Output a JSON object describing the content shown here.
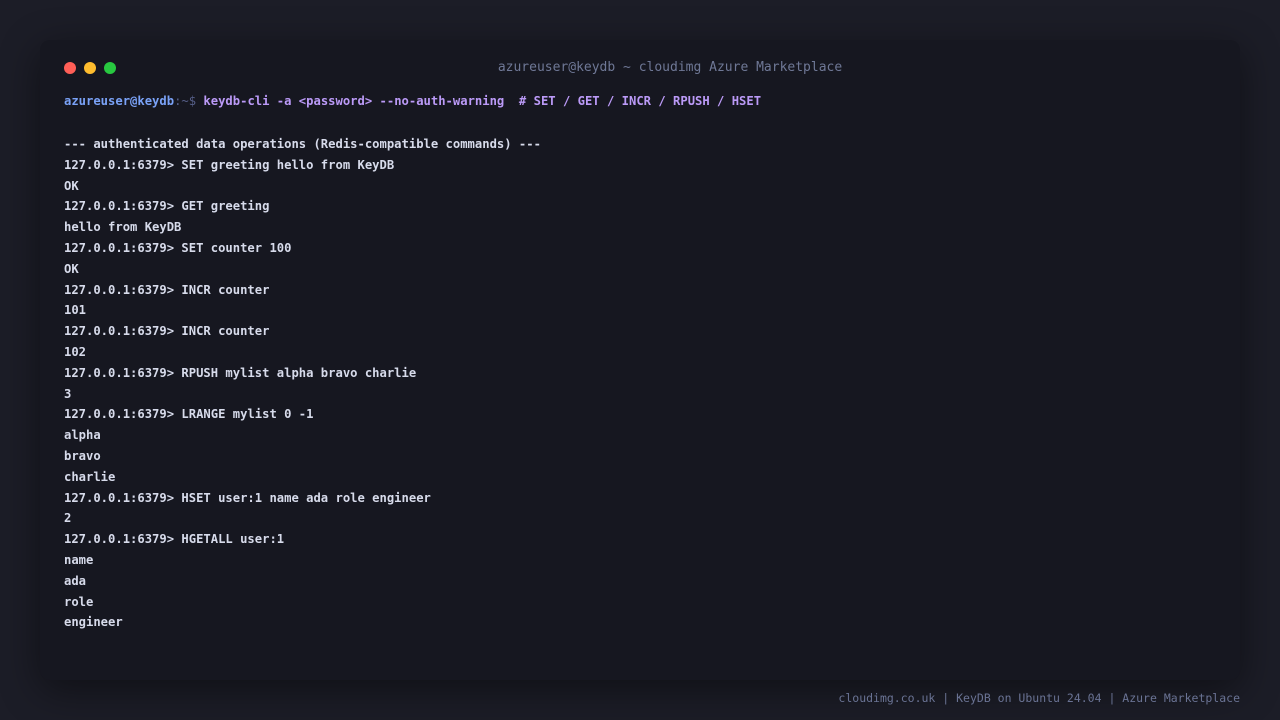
{
  "window": {
    "title": "azureuser@keydb ~ cloudimg Azure Marketplace"
  },
  "prompt": {
    "user_host": "azureuser@keydb",
    "path_symbol": ":~$",
    "command": "keydb-cli -a <password> --no-auth-warning  # SET / GET / INCR / RPUSH / HSET"
  },
  "output_lines": [
    "--- authenticated data operations (Redis-compatible commands) ---",
    "127.0.0.1:6379> SET greeting hello from KeyDB",
    "OK",
    "127.0.0.1:6379> GET greeting",
    "hello from KeyDB",
    "127.0.0.1:6379> SET counter 100",
    "OK",
    "127.0.0.1:6379> INCR counter",
    "101",
    "127.0.0.1:6379> INCR counter",
    "102",
    "127.0.0.1:6379> RPUSH mylist alpha bravo charlie",
    "3",
    "127.0.0.1:6379> LRANGE mylist 0 -1",
    "alpha",
    "bravo",
    "charlie",
    "127.0.0.1:6379> HSET user:1 name ada role engineer",
    "2",
    "127.0.0.1:6379> HGETALL user:1",
    "name",
    "ada",
    "role",
    "engineer"
  ],
  "footer": {
    "text": "cloudimg.co.uk | KeyDB on Ubuntu 24.04 | Azure Marketplace"
  },
  "colors": {
    "background": "#1c1d27",
    "terminal": "#161720",
    "close_dot": "#ff5f57",
    "minimize_dot": "#febc2e",
    "maximize_dot": "#28c840",
    "prompt_user": "#7aa2f7",
    "prompt_command": "#bb9af7",
    "output_text": "#d7dbeb"
  }
}
